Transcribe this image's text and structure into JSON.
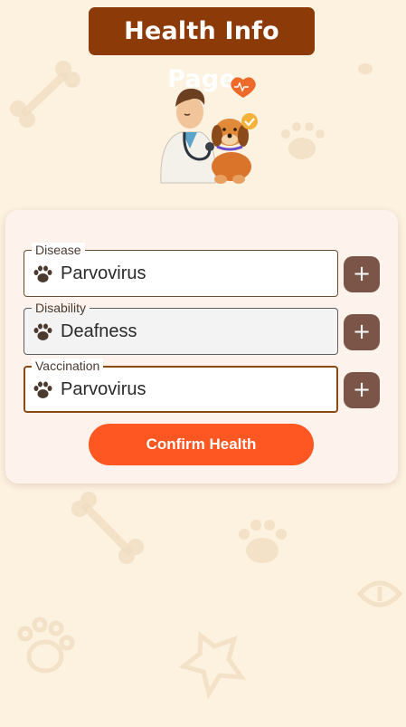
{
  "header": {
    "title": "Health Info Page"
  },
  "hero": {
    "icon": "vet-with-dog-illustration"
  },
  "form": {
    "fields": [
      {
        "label": "Disease",
        "value": "Parvovirus",
        "state": "normal",
        "icon": "paw-icon"
      },
      {
        "label": "Disability",
        "value": "Deafness",
        "state": "disabled",
        "icon": "paw-icon"
      },
      {
        "label": "Vaccination",
        "value": "Parvovirus",
        "state": "focused",
        "icon": "paw-icon"
      }
    ],
    "add_button_label": "+",
    "confirm_label": "Confirm Health"
  },
  "colors": {
    "background": "#fdf1e0",
    "title_bg": "#8b3a08",
    "add_button": "#7a5548",
    "confirm_button": "#ff5722"
  }
}
